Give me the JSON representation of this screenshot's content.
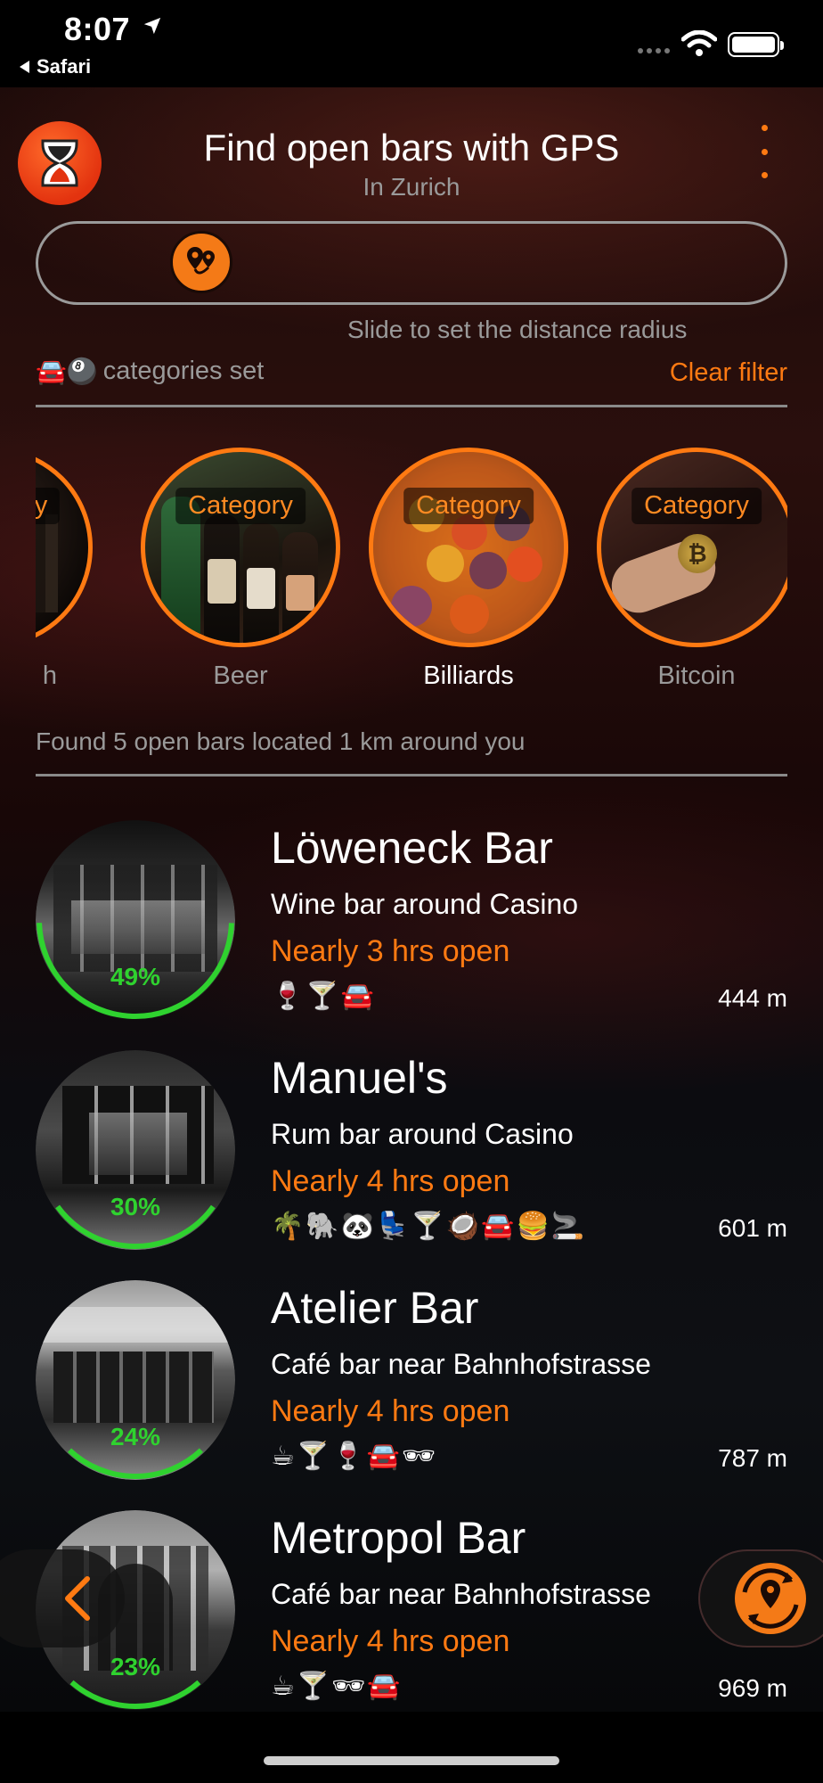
{
  "status_bar": {
    "time": "8:07",
    "back_app": "Safari"
  },
  "header": {
    "title": "Find open bars with GPS",
    "subtitle": "In Zurich"
  },
  "filter": {
    "slider_hint": "Slide to set the distance radius",
    "active_emojis": "🚘🎱",
    "categories_text": "categories set",
    "clear_label": "Clear filter"
  },
  "categories": [
    {
      "tag": "Category",
      "label": "Beach",
      "shown_tag": "gory",
      "shown_label": "h",
      "selected": false
    },
    {
      "tag": "Category",
      "label": "Beer",
      "shown_tag": "Category",
      "shown_label": "Beer",
      "selected": false
    },
    {
      "tag": "Category",
      "label": "Billiards",
      "shown_tag": "Category",
      "shown_label": "Billiards",
      "selected": true
    },
    {
      "tag": "Category",
      "label": "Bitcoin",
      "shown_tag": "Category",
      "shown_label": "Bitcoin",
      "selected": false
    }
  ],
  "found_text": "Found 5 open bars located 1 km around you",
  "bars": [
    {
      "name": "Löweneck Bar",
      "desc": "Wine bar around Casino",
      "open": "Nearly 3 hrs open",
      "emojis": "🍷🍸🚘",
      "distance": "444 m",
      "percent_label": "49%",
      "percent": 49
    },
    {
      "name": "Manuel's",
      "desc": "Rum bar around Casino",
      "open": "Nearly 4 hrs open",
      "emojis": "🌴🐘🐼💺🍸🥥🚘🍔🚬",
      "distance": "601 m",
      "percent_label": "30%",
      "percent": 30
    },
    {
      "name": "Atelier Bar",
      "desc": "Café bar near Bahnhofstrasse",
      "open": "Nearly 4 hrs open",
      "emojis": "☕🍸🍷🚘🕶",
      "distance": "787 m",
      "percent_label": "24%",
      "percent": 24
    },
    {
      "name": "Metropol Bar",
      "desc": "Café bar near Bahnhofstrasse",
      "open": "Nearly 4 hrs open",
      "emojis": "☕🍸🕶🚘",
      "distance": "969 m",
      "percent_label": "23%",
      "percent": 23
    }
  ],
  "icons": {
    "logo": "hourglass-icon",
    "menu": "more-vertical-icon",
    "slider_thumb": "map-pins-icon",
    "back": "chevron-left-icon",
    "locate": "location-refresh-icon"
  },
  "colors": {
    "accent": "#ff7a12",
    "progress": "#2fd22f",
    "muted_text": "#9a9a9a"
  }
}
